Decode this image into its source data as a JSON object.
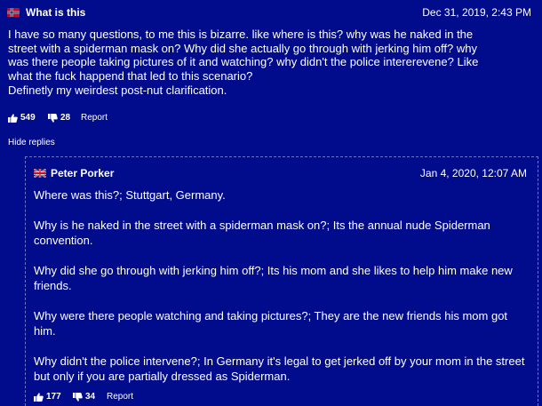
{
  "top_comment": {
    "author": "What is this",
    "date": "Dec 31, 2019, 2:43 PM",
    "text_lines": [
      "I have so many questions, to me this is bizarre. like where is this? why was he naked in the",
      "street with a spiderman mask on? Why did she actually go through with jerking him off? why",
      "was there people taking pictures of it and watching? why didn't the police intererevene? Like",
      "what the fuck happend that led to this scenario?",
      "Definetly my weirdest post-nut clarification."
    ],
    "likes": "549",
    "dislikes": "28",
    "report_label": "Report"
  },
  "hide_replies_label": "Hide replies",
  "reply": {
    "author": "Peter Porker",
    "date": "Jan 4, 2020, 12:07 AM",
    "paragraphs": [
      "Where was this?; Stuttgart, Germany.",
      "Why is he naked in the street with a spiderman mask on?; Its the annual nude Spiderman convention.",
      "Why did she go through with jerking him off?; Its his mom and she likes to help him make new friends.",
      "Why were there people watching and taking pictures?; They are the new friends his mom got him.",
      "Why didn't the police intervene?; In Germany it's legal to get jerked off by your mom in the street but only if you are partially dressed as Spiderman."
    ],
    "likes": "177",
    "dislikes": "34",
    "report_label": "Report"
  },
  "icons": {
    "top_flag": "norway-flag-icon",
    "reply_flag": "uk-flag-icon",
    "like": "thumbs-up-icon",
    "dislike": "thumbs-down-icon"
  },
  "colors": {
    "background": "#000c8c",
    "text": "#ffffff"
  }
}
